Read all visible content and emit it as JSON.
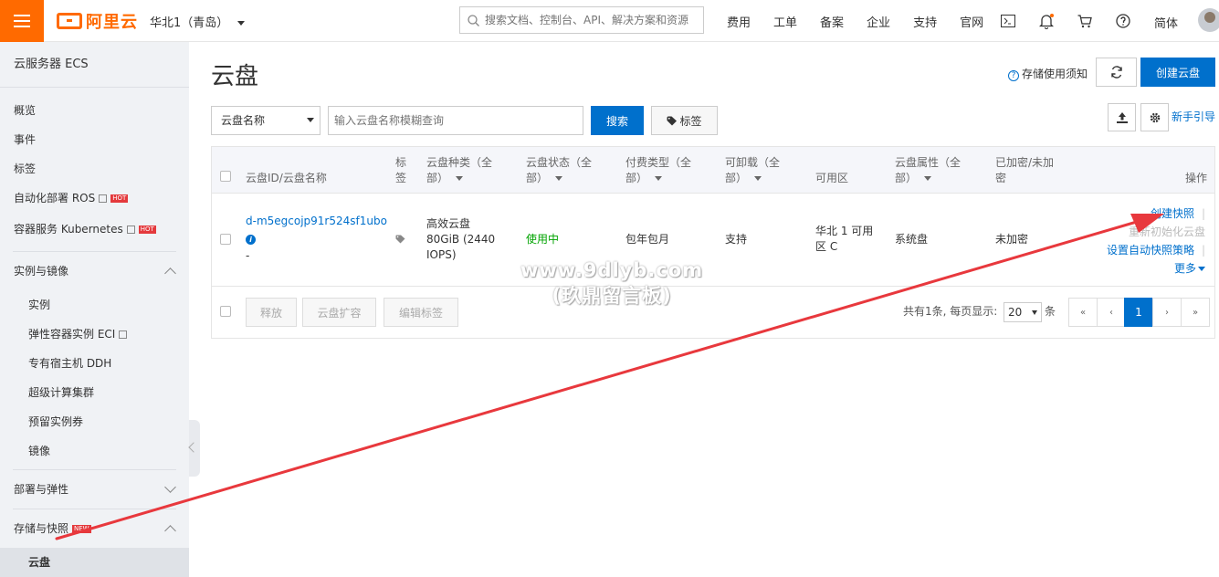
{
  "header": {
    "logo_text": "阿里云",
    "region": "华北1（青岛）",
    "search_placeholder": "搜索文档、控制台、API、解决方案和资源",
    "nav": [
      "费用",
      "工单",
      "备案",
      "企业",
      "支持",
      "官网"
    ],
    "lang": "简体",
    "brand_color": "#ff6a00"
  },
  "sidebar": {
    "title": "云服务器 ECS",
    "items_top": [
      {
        "label": "概览"
      },
      {
        "label": "事件"
      },
      {
        "label": "标签"
      },
      {
        "label": "自动化部署 ROS",
        "badge": "HOT"
      },
      {
        "label": "容器服务 Kubernetes",
        "badge": "HOT"
      }
    ],
    "group_instances": {
      "label": "实例与镜像",
      "items": [
        "实例",
        "弹性容器实例 ECI",
        "专有宿主机 DDH",
        "超级计算集群",
        "预留实例券",
        "镜像"
      ]
    },
    "group_deploy": {
      "label": "部署与弹性"
    },
    "group_storage": {
      "label": "存储与快照",
      "badge": "NEW",
      "items": [
        "云盘"
      ]
    }
  },
  "main": {
    "title": "云盘",
    "help_link": "存储使用须知",
    "create_button": "创建云盘",
    "filter_select": "云盘名称",
    "filter_placeholder": "输入云盘名称模糊查询",
    "search_button": "搜索",
    "tag_button": "标签",
    "guide_link": "新手引导"
  },
  "table": {
    "headers": {
      "id": "云盘ID/云盘名称",
      "tag": "标签",
      "category_line1": "云盘种类（全",
      "category_line2": "部）",
      "status_line1": "云盘状态（全",
      "status_line2": "部）",
      "billing_line1": "付费类型（全",
      "billing_line2": "部）",
      "detachable_line1": "可卸载（全",
      "detachable_line2": "部）",
      "zone": "可用区",
      "attr_line1": "云盘属性（全",
      "attr_line2": "部）",
      "encrypt_line1": "已加密/未加",
      "encrypt_line2": "密",
      "actions": "操作"
    },
    "row": {
      "id": "d-m5egcojp91r524sf1ubo",
      "name": "-",
      "category_line1": "高效云盘",
      "category_line2": "80GiB (2440",
      "category_line3": "IOPS)",
      "status": "使用中",
      "billing": "包年包月",
      "detachable": "支持",
      "zone_line1": "华北 1 可用",
      "zone_line2": "区 C",
      "attr": "系统盘",
      "encrypt": "未加密",
      "action1": "创建快照",
      "action2": "重新初始化云盘",
      "action3": "设置自动快照策略",
      "action_more": "更多"
    },
    "footer": {
      "release": "释放",
      "expand": "云盘扩容",
      "edit_tags": "编辑标签",
      "total": "共有1条, 每页显示:",
      "page_size": "20",
      "unit": "条",
      "pages": [
        "«",
        "‹",
        "1",
        "›",
        "»"
      ]
    }
  },
  "watermark": {
    "line1": "www.9dlyb.com",
    "line2": "(玖鼎留言板)"
  },
  "annotation_color": "#e8383d"
}
